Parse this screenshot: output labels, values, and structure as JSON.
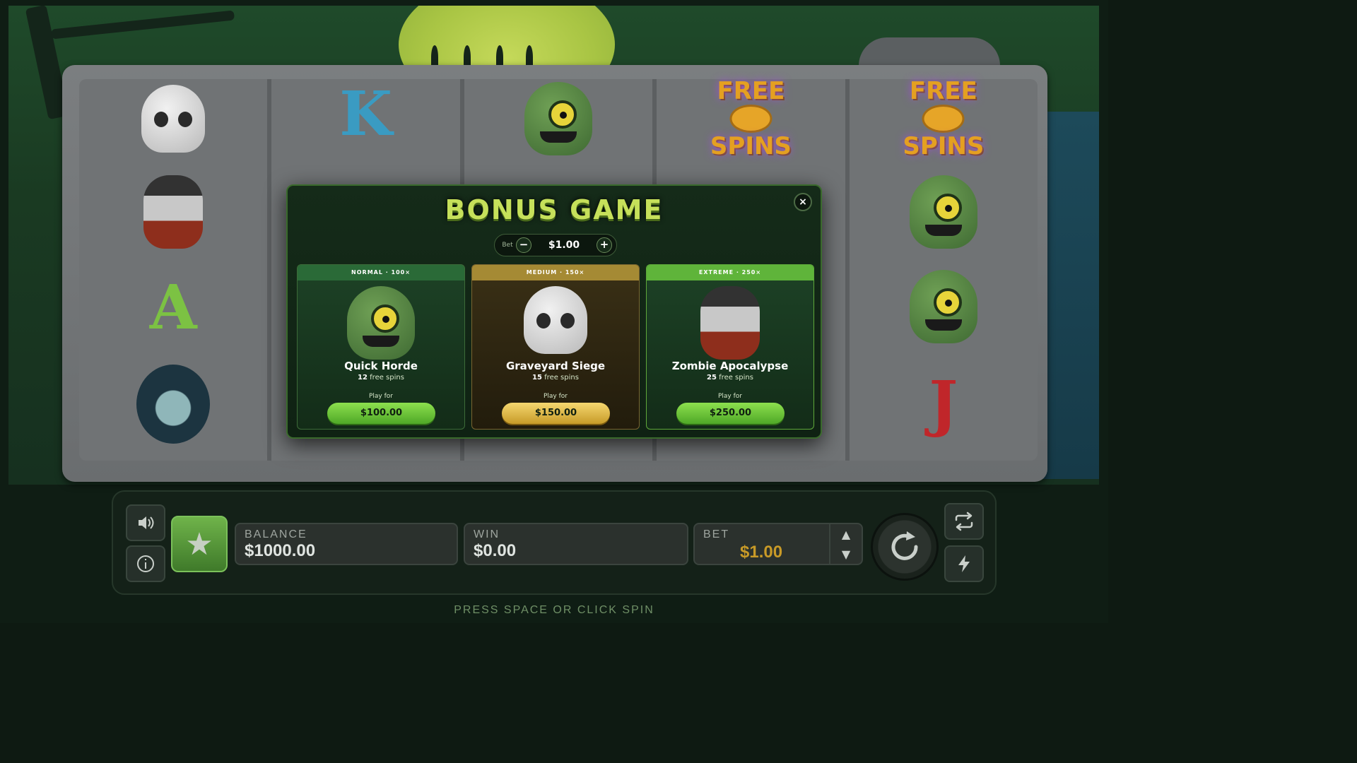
{
  "modal": {
    "title": "BONUS GAME",
    "close_label": "×",
    "bet_label": "Bet",
    "bet_minus": "−",
    "bet_amount": "$1.00",
    "bet_plus": "+",
    "options": [
      {
        "tier": "NORMAL · 100×",
        "name": "Quick Horde",
        "spins_count": "12",
        "spins_text": "free spins",
        "play_for": "Play for",
        "price": "$100.00",
        "icon": "green-zombie-head"
      },
      {
        "tier": "MEDIUM · 150×",
        "name": "Graveyard Siege",
        "spins_count": "15",
        "spins_text": "free spins",
        "play_for": "Play for",
        "price": "$150.00",
        "icon": "skull"
      },
      {
        "tier": "EXTREME · 250×",
        "name": "Zombie Apocalypse",
        "spins_count": "25",
        "spins_text": "free spins",
        "play_for": "Play for",
        "price": "$250.00",
        "icon": "zombie-man-head"
      }
    ]
  },
  "reels": {
    "symbols": {
      "reel1": [
        "skull",
        "zombie-man-head",
        "letter-A",
        "ghost-lady"
      ],
      "reel2": [
        "letter-K"
      ],
      "reel3": [
        "green-zombie-head"
      ],
      "reel4": [
        "free-spins"
      ],
      "reel5": [
        "free-spins",
        "green-zombie-head",
        "green-zombie-head",
        "letter-J"
      ]
    },
    "letter_a": "A",
    "letter_k": "K",
    "letter_j": "J",
    "free_spins_top": "FREE",
    "free_spins_bottom": "SPINS"
  },
  "controls": {
    "balance_label": "BALANCE",
    "balance_value": "$1000.00",
    "win_label": "WIN",
    "win_value": "$0.00",
    "bet_label": "BET",
    "bet_value": "$1.00",
    "hint": "PRESS SPACE OR CLICK SPIN"
  },
  "colors": {
    "accent_green": "#8de04e",
    "gold": "#c89a27",
    "title_green": "#c6e05a"
  }
}
